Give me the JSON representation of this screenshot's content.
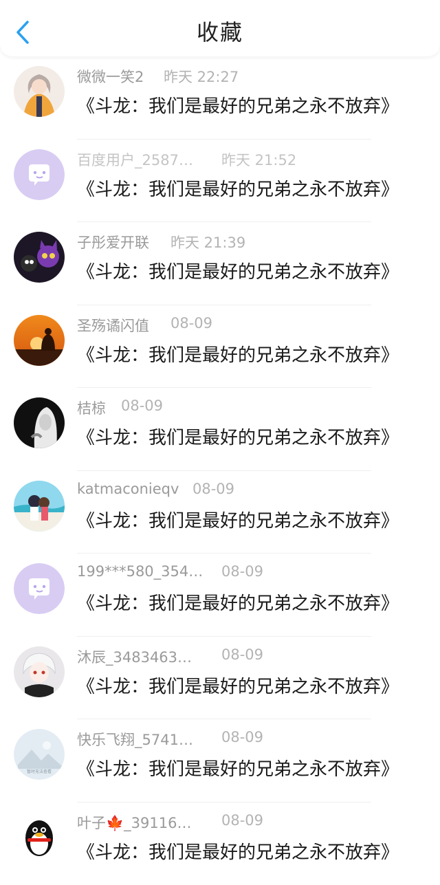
{
  "header": {
    "title": "收藏"
  },
  "items": [
    {
      "name": "微微一笑2",
      "time": "昨天 22:27",
      "content": "《斗龙：我们是最好的兄弟之永不放弃》",
      "avatar": "anime-girl-avatar"
    },
    {
      "name": "百度用户_2587…",
      "time": "昨天 21:52",
      "content": "《斗龙：我们是最好的兄弟之永不放弃》",
      "avatar": "default-chat-avatar"
    },
    {
      "name": "子彤爱开联",
      "time": "昨天 21:39",
      "content": "《斗龙：我们是最好的兄弟之永不放弃》",
      "avatar": "cartoon-cats-avatar"
    },
    {
      "name": "圣殇谲闪值",
      "time": "08-09",
      "content": "《斗龙：我们是最好的兄弟之永不放弃》",
      "avatar": "sunset-buddha-avatar"
    },
    {
      "name": "桔椋",
      "time": "08-09",
      "content": "《斗龙：我们是最好的兄弟之永不放弃》",
      "avatar": "dark-portrait-avatar"
    },
    {
      "name": "katmaconieqv",
      "time": "08-09",
      "content": "《斗龙：我们是最好的兄弟之永不放弃》",
      "avatar": "beach-couple-avatar"
    },
    {
      "name": "199***580_354…",
      "time": "08-09",
      "content": "《斗龙：我们是最好的兄弟之永不放弃》",
      "avatar": "default-chat-avatar"
    },
    {
      "name": "沐辰_3483463…",
      "time": "08-09",
      "content": "《斗龙：我们是最好的兄弟之永不放弃》",
      "avatar": "anime-boy-avatar"
    },
    {
      "name": "快乐飞翔_5741…",
      "time": "08-09",
      "content": "《斗龙：我们是最好的兄弟之永不放弃》",
      "avatar": "placeholder-image-avatar",
      "avatar_caption": "暂时无法查看"
    },
    {
      "name": "叶子🍁_39116…",
      "time": "08-09",
      "content": "《斗龙：我们是最好的兄弟之永不放弃》",
      "avatar": "penguin-avatar"
    }
  ],
  "colors": {
    "accent": "#2aa0f0",
    "default_avatar": "#d8ccf3"
  }
}
